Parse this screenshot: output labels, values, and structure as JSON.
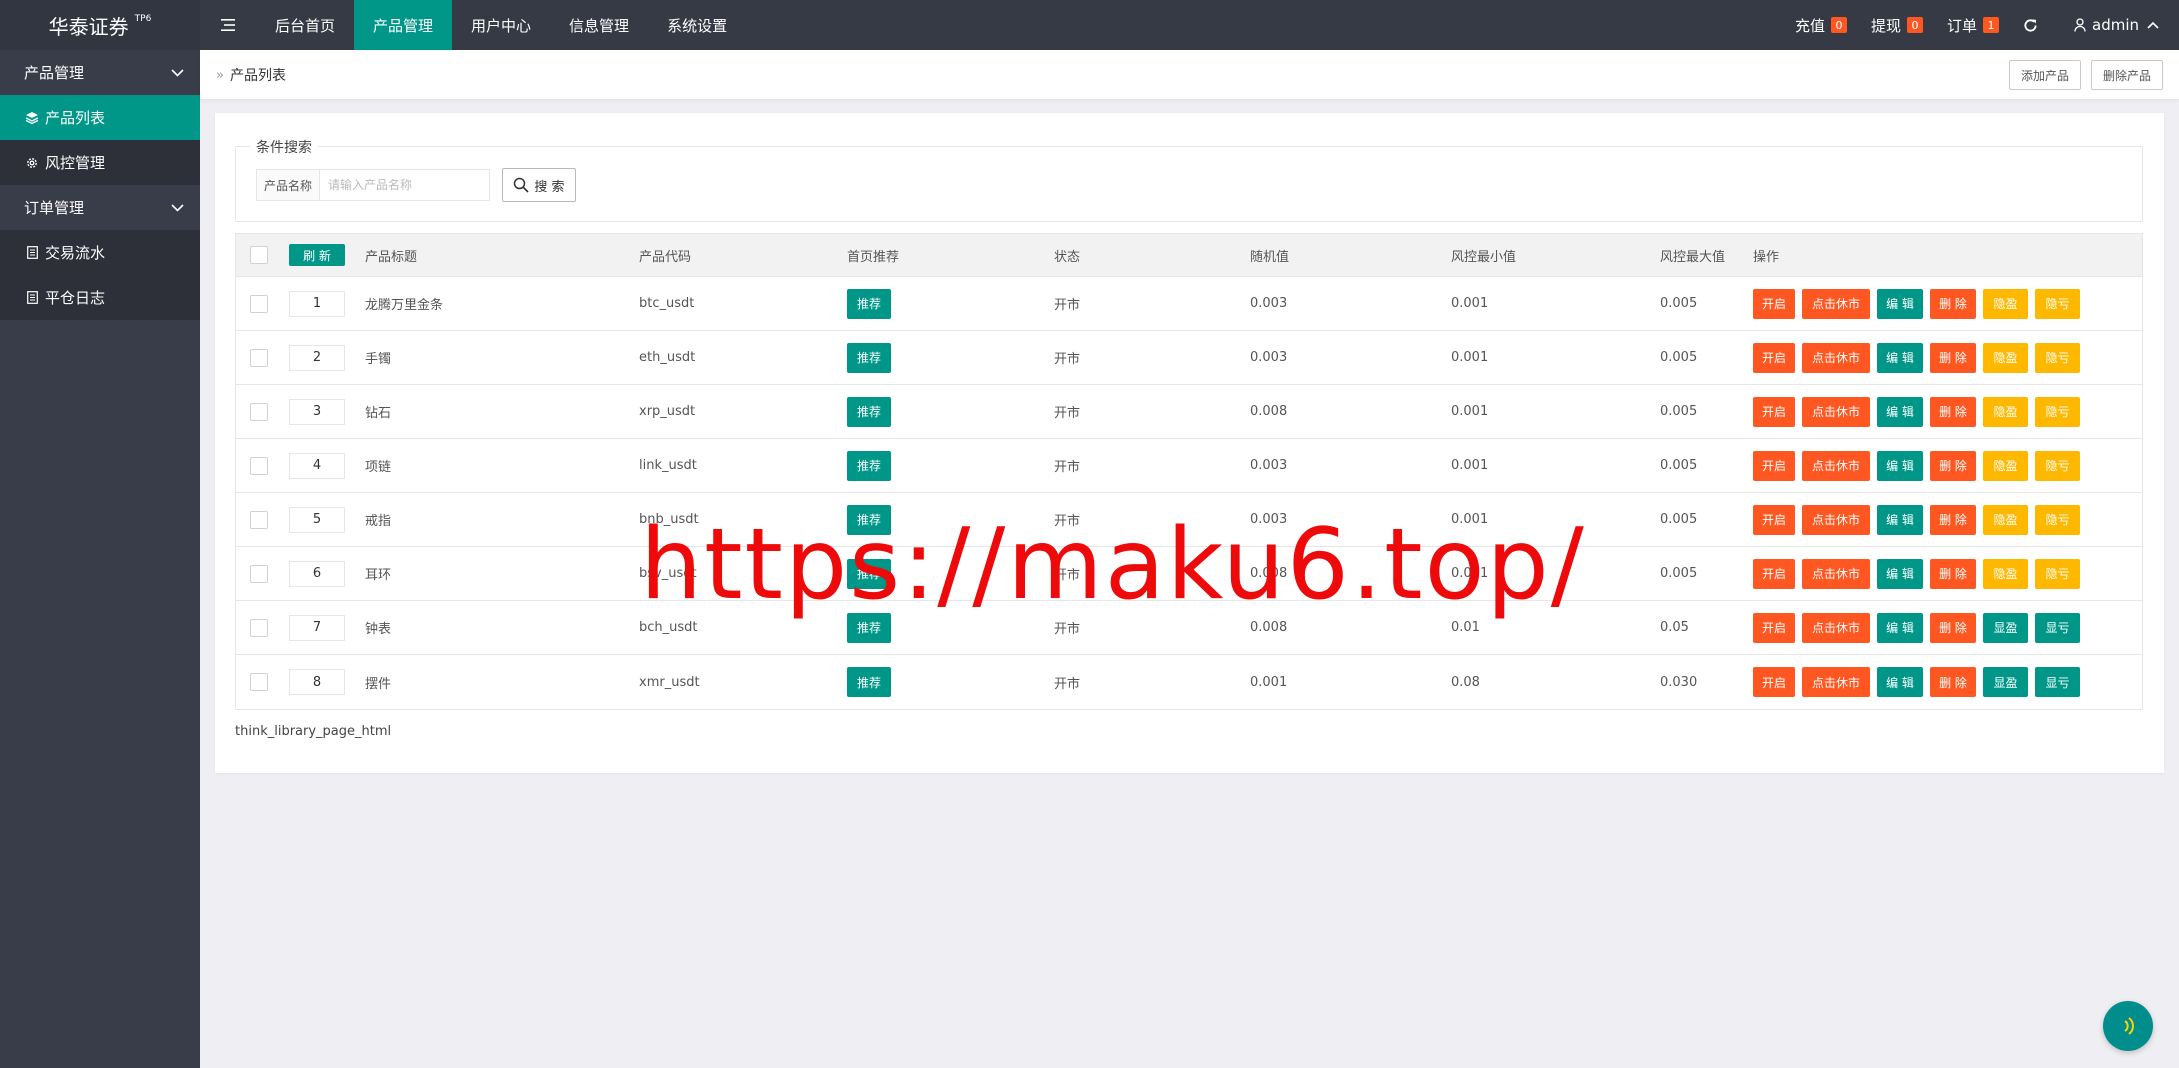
{
  "header": {
    "logo": "华泰证券",
    "logo_sup": "TP6",
    "nav": [
      "后台首页",
      "产品管理",
      "用户中心",
      "信息管理",
      "系统设置"
    ],
    "active_nav": 1,
    "recharge": {
      "label": "充值",
      "count": "0"
    },
    "withdraw": {
      "label": "提现",
      "count": "0"
    },
    "orders": {
      "label": "订单",
      "count": "1"
    },
    "user": "admin"
  },
  "sidebar": {
    "group1": "产品管理",
    "item_products": "产品列表",
    "item_risk": "风控管理",
    "group2": "订单管理",
    "item_trades": "交易流水",
    "item_close_log": "平仓日志"
  },
  "breadcrumb": {
    "title": "产品列表",
    "add_label": "添加产品",
    "delete_label": "删除产品"
  },
  "search": {
    "legend": "条件搜索",
    "label": "产品名称",
    "placeholder": "请输入产品名称",
    "button": "搜 索"
  },
  "table": {
    "refresh_label": "刷 新",
    "headers": {
      "title": "产品标题",
      "code": "产品代码",
      "recommend": "首页推荐",
      "status": "状态",
      "random": "随机值",
      "risk_min": "风控最小值",
      "risk_max": "风控最大值",
      "ops": "操作"
    },
    "rows": [
      {
        "sort": "1",
        "title": "龙腾万里金条",
        "code": "btc_usdt",
        "recommend": "推荐",
        "status": "开市",
        "random": "0.003",
        "risk_min": "0.001",
        "risk_max": "0.005",
        "ops": [
          "开启",
          "点击休市",
          "编 辑",
          "删 除",
          "隐盈",
          "隐亏"
        ]
      },
      {
        "sort": "2",
        "title": "手镯",
        "code": "eth_usdt",
        "recommend": "推荐",
        "status": "开市",
        "random": "0.003",
        "risk_min": "0.001",
        "risk_max": "0.005",
        "ops": [
          "开启",
          "点击休市",
          "编 辑",
          "删 除",
          "隐盈",
          "隐亏"
        ]
      },
      {
        "sort": "3",
        "title": "钻石",
        "code": "xrp_usdt",
        "recommend": "推荐",
        "status": "开市",
        "random": "0.008",
        "risk_min": "0.001",
        "risk_max": "0.005",
        "ops": [
          "开启",
          "点击休市",
          "编 辑",
          "删 除",
          "隐盈",
          "隐亏"
        ]
      },
      {
        "sort": "4",
        "title": "项链",
        "code": "link_usdt",
        "recommend": "推荐",
        "status": "开市",
        "random": "0.003",
        "risk_min": "0.001",
        "risk_max": "0.005",
        "ops": [
          "开启",
          "点击休市",
          "编 辑",
          "删 除",
          "隐盈",
          "隐亏"
        ]
      },
      {
        "sort": "5",
        "title": "戒指",
        "code": "bnb_usdt",
        "recommend": "推荐",
        "status": "开市",
        "random": "0.003",
        "risk_min": "0.001",
        "risk_max": "0.005",
        "ops": [
          "开启",
          "点击休市",
          "编 辑",
          "删 除",
          "隐盈",
          "隐亏"
        ]
      },
      {
        "sort": "6",
        "title": "耳环",
        "code": "bsv_usdt",
        "recommend": "推荐",
        "status": "开市",
        "random": "0.008",
        "risk_min": "0.001",
        "risk_max": "0.005",
        "ops": [
          "开启",
          "点击休市",
          "编 辑",
          "删 除",
          "隐盈",
          "隐亏"
        ]
      },
      {
        "sort": "7",
        "title": "钟表",
        "code": "bch_usdt",
        "recommend": "推荐",
        "status": "开市",
        "random": "0.008",
        "risk_min": "0.01",
        "risk_max": "0.05",
        "ops": [
          "开启",
          "点击休市",
          "编 辑",
          "删 除",
          "显盈",
          "显亏"
        ]
      },
      {
        "sort": "8",
        "title": "摆件",
        "code": "xmr_usdt",
        "recommend": "推荐",
        "status": "开市",
        "random": "0.001",
        "risk_min": "0.08",
        "risk_max": "0.030",
        "ops": [
          "开启",
          "点击休市",
          "编 辑",
          "删 除",
          "显盈",
          "显亏"
        ]
      }
    ]
  },
  "pager_text": "think_library_page_html",
  "watermark": "https://maku6.top/",
  "colors": {
    "primary": "#009688",
    "danger": "#ff5722",
    "warning": "#ffb800",
    "header": "#363a45",
    "sidebar": "#393d49"
  }
}
